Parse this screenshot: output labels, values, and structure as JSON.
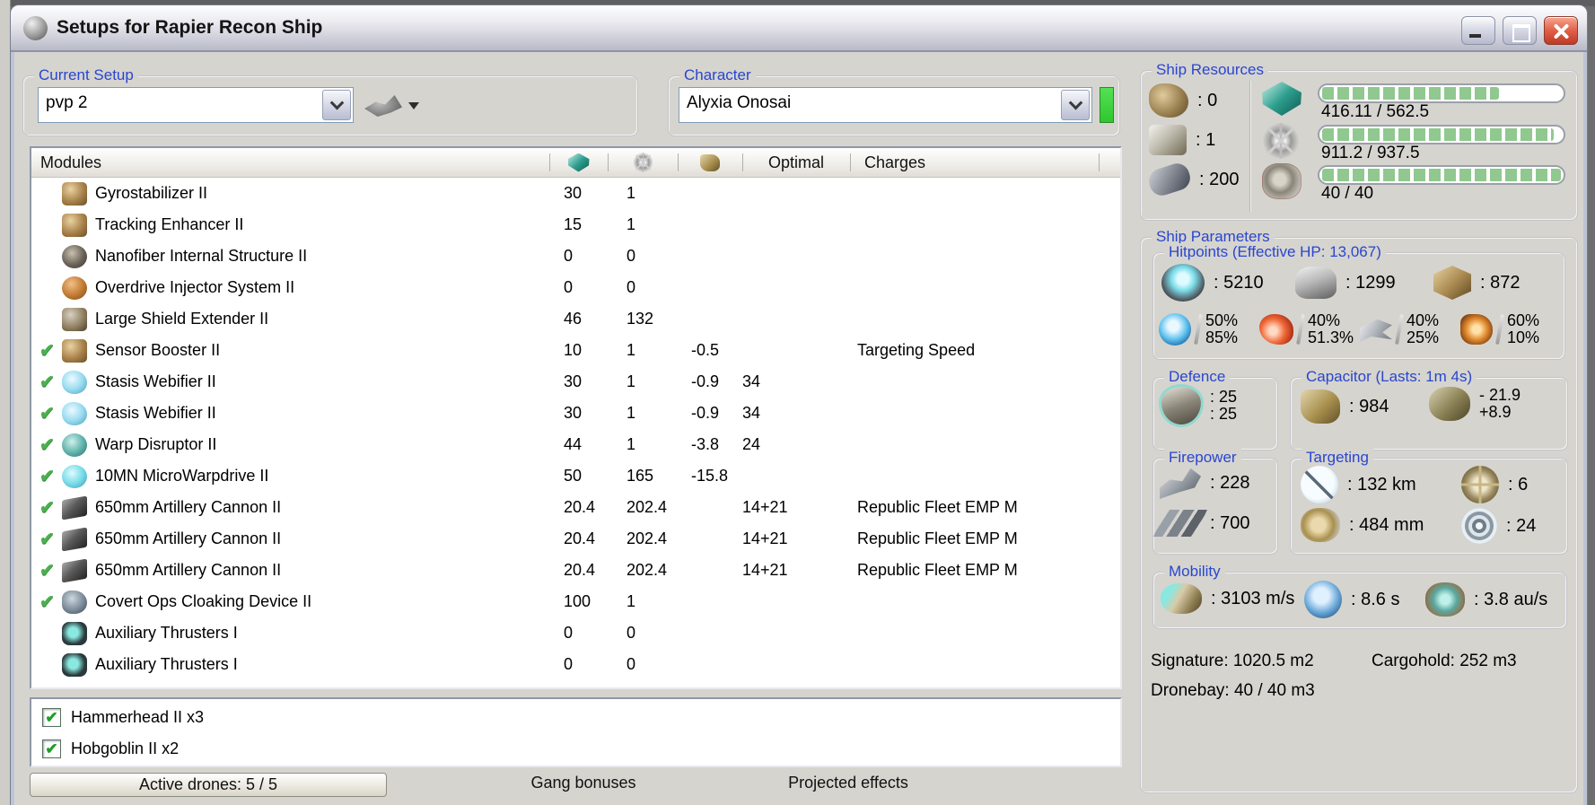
{
  "window": {
    "title": "Setups for Rapier Recon Ship"
  },
  "current_setup": {
    "label": "Current Setup",
    "value": "pvp 2"
  },
  "character": {
    "label": "Character",
    "value": "Alyxia Onosai"
  },
  "ship_resources": {
    "label": "Ship Resources",
    "slots": [
      {
        "icon": "turret-hardpoints-icon",
        "value": ": 0"
      },
      {
        "icon": "launcher-hardpoints-icon",
        "value": ": 1"
      },
      {
        "icon": "calibration-icon",
        "value": ": 200"
      }
    ],
    "bars": [
      {
        "icon": "cpu-icon",
        "text": "416.11 / 562.5",
        "pct": 74
      },
      {
        "icon": "powergrid-icon",
        "text": "911.2 / 937.5",
        "pct": 97
      },
      {
        "icon": "dronebay-icon",
        "text": "40 / 40",
        "pct": 100
      }
    ]
  },
  "modules_table": {
    "header": {
      "modules": "Modules",
      "optimal": "Optimal",
      "charges": "Charges"
    },
    "rows": [
      {
        "active": false,
        "icon": "gyrostabilizer-icon",
        "style": "tan",
        "name": "Gyrostabilizer II",
        "cpu": "30",
        "pg": "1",
        "cap": "",
        "optimal": "",
        "charge": ""
      },
      {
        "active": false,
        "icon": "tracking-enhancer-icon",
        "style": "tan",
        "name": "Tracking Enhancer II",
        "cpu": "15",
        "pg": "1",
        "cap": "",
        "optimal": "",
        "charge": ""
      },
      {
        "active": false,
        "icon": "nanofiber-icon",
        "style": "gear",
        "name": "Nanofiber Internal Structure II",
        "cpu": "0",
        "pg": "0",
        "cap": "",
        "optimal": "",
        "charge": ""
      },
      {
        "active": false,
        "icon": "overdrive-icon",
        "style": "orange",
        "name": "Overdrive Injector System II",
        "cpu": "0",
        "pg": "0",
        "cap": "",
        "optimal": "",
        "charge": ""
      },
      {
        "active": false,
        "icon": "shield-extender-icon",
        "style": "shield",
        "name": "Large Shield Extender II",
        "cpu": "46",
        "pg": "132",
        "cap": "",
        "optimal": "",
        "charge": ""
      },
      {
        "active": true,
        "icon": "sensor-booster-icon",
        "style": "tan",
        "name": "Sensor Booster II",
        "cpu": "10",
        "pg": "1",
        "cap": "-0.5",
        "optimal": "",
        "charge": "Targeting Speed"
      },
      {
        "active": true,
        "icon": "stasis-webifier-icon",
        "style": "ice",
        "name": "Stasis Webifier II",
        "cpu": "30",
        "pg": "1",
        "cap": "-0.9",
        "optimal": "34",
        "charge": ""
      },
      {
        "active": true,
        "icon": "stasis-webifier-icon",
        "style": "ice",
        "name": "Stasis Webifier II",
        "cpu": "30",
        "pg": "1",
        "cap": "-0.9",
        "optimal": "34",
        "charge": ""
      },
      {
        "active": true,
        "icon": "warp-disruptor-icon",
        "style": "teal",
        "name": "Warp Disruptor II",
        "cpu": "44",
        "pg": "1",
        "cap": "-3.8",
        "optimal": "24",
        "charge": ""
      },
      {
        "active": true,
        "icon": "microwarpdrive-icon",
        "style": "cyan",
        "name": "10MN MicroWarpdrive II",
        "cpu": "50",
        "pg": "165",
        "cap": "-15.8",
        "optimal": "",
        "charge": ""
      },
      {
        "active": true,
        "icon": "artillery-cannon-icon",
        "style": "gun",
        "name": "650mm Artillery Cannon II",
        "cpu": "20.4",
        "pg": "202.4",
        "cap": "",
        "optimal": "14+21",
        "charge": "Republic Fleet EMP M"
      },
      {
        "active": true,
        "icon": "artillery-cannon-icon",
        "style": "gun",
        "name": "650mm Artillery Cannon II",
        "cpu": "20.4",
        "pg": "202.4",
        "cap": "",
        "optimal": "14+21",
        "charge": "Republic Fleet EMP M"
      },
      {
        "active": true,
        "icon": "artillery-cannon-icon",
        "style": "gun",
        "name": "650mm Artillery Cannon II",
        "cpu": "20.4",
        "pg": "202.4",
        "cap": "",
        "optimal": "14+21",
        "charge": "Republic Fleet EMP M"
      },
      {
        "active": true,
        "icon": "cloaking-device-icon",
        "style": "cloak",
        "name": "Covert Ops Cloaking Device II",
        "cpu": "100",
        "pg": "1",
        "cap": "",
        "optimal": "",
        "charge": ""
      },
      {
        "active": false,
        "icon": "auxiliary-thrusters-icon",
        "style": "thruster",
        "name": "Auxiliary Thrusters I",
        "cpu": "0",
        "pg": "0",
        "cap": "",
        "optimal": "",
        "charge": ""
      },
      {
        "active": false,
        "icon": "auxiliary-thrusters-icon",
        "style": "thruster",
        "name": "Auxiliary Thrusters I",
        "cpu": "0",
        "pg": "0",
        "cap": "",
        "optimal": "",
        "charge": ""
      }
    ]
  },
  "drones": [
    {
      "checked": true,
      "label": "Hammerhead II x3"
    },
    {
      "checked": true,
      "label": "Hobgoblin II x2"
    }
  ],
  "footer": {
    "active_drones": "Active drones: 5 / 5",
    "gang_bonuses": "Gang bonuses",
    "projected_effects": "Projected effects"
  },
  "ship_parameters": {
    "label": "Ship Parameters",
    "hitpoints": {
      "label": "Hitpoints (Effective HP: 13,067)",
      "shield": ": 5210",
      "armor": ": 1299",
      "hull": ": 872",
      "resists": [
        {
          "icon": "em-resist-icon",
          "style": "em",
          "top": "50%",
          "bottom": "85%"
        },
        {
          "icon": "thermal-resist-icon",
          "style": "thermal",
          "top": "40%",
          "bottom": "51.3%"
        },
        {
          "icon": "kinetic-resist-icon",
          "style": "kinetic",
          "top": "40%",
          "bottom": "25%"
        },
        {
          "icon": "explosive-resist-icon",
          "style": "explosive",
          "top": "60%",
          "bottom": "10%"
        }
      ]
    },
    "defence": {
      "label": "Defence",
      "line1": ": 25",
      "line2": ": 25"
    },
    "capacitor": {
      "label": "Capacitor (Lasts: 1m 4s)",
      "amount": ": 984",
      "delta_minus": "- 21.9",
      "delta_plus": "+8.9"
    },
    "firepower": {
      "label": "Firepower",
      "dps": ": 228",
      "volley": ": 700"
    },
    "targeting": {
      "label": "Targeting",
      "range": ": 132 km",
      "max_targets": ": 6",
      "scan_resolution": ": 484 mm",
      "sensor_strength": ": 24"
    },
    "mobility": {
      "label": "Mobility",
      "speed": ": 3103 m/s",
      "align_time": ": 8.6 s",
      "warp_speed": ": 3.8 au/s"
    },
    "signature": "Signature: 1020.5 m2",
    "cargohold": "Cargohold: 252 m3",
    "dronebay": "Dronebay: 40 / 40 m3"
  }
}
